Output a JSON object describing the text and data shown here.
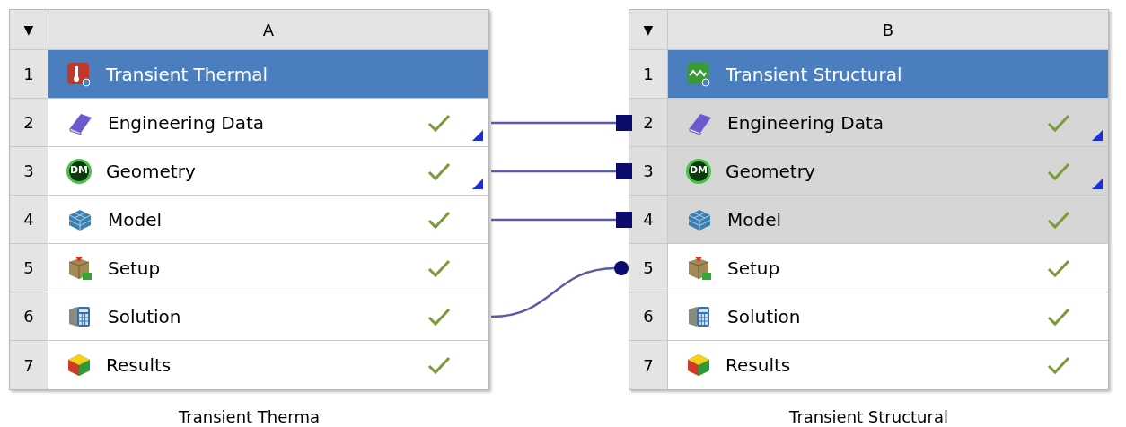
{
  "systems": [
    {
      "column": "A",
      "menu_glyph": "▼",
      "caption": "Transient Therma",
      "rows": [
        {
          "number": "1",
          "kind": "thermal",
          "label": "Transient Thermal",
          "selected": true,
          "shared": false,
          "complete": false,
          "linked": false,
          "connected": false
        },
        {
          "number": "2",
          "kind": "engineering_data",
          "label": "Engineering Data",
          "selected": false,
          "shared": false,
          "complete": true,
          "linked": true,
          "connected": true
        },
        {
          "number": "3",
          "kind": "geometry",
          "icon_label": "DM",
          "label": "Geometry",
          "selected": false,
          "shared": false,
          "complete": true,
          "linked": true,
          "connected": true
        },
        {
          "number": "4",
          "kind": "model",
          "label": "Model",
          "selected": false,
          "shared": false,
          "complete": true,
          "linked": false,
          "connected": true
        },
        {
          "number": "5",
          "kind": "setup",
          "label": "Setup",
          "selected": false,
          "shared": false,
          "complete": true,
          "linked": false,
          "connected": false
        },
        {
          "number": "6",
          "kind": "solution",
          "label": "Solution",
          "selected": false,
          "shared": false,
          "complete": true,
          "linked": false,
          "connected": true
        },
        {
          "number": "7",
          "kind": "results",
          "label": "Results",
          "selected": false,
          "shared": false,
          "complete": true,
          "linked": false,
          "connected": false
        }
      ]
    },
    {
      "column": "B",
      "menu_glyph": "▼",
      "caption": "Transient Structural",
      "rows": [
        {
          "number": "1",
          "kind": "structural",
          "label": "Transient Structural",
          "selected": true,
          "shared": false,
          "complete": false,
          "linked": false,
          "connected": false
        },
        {
          "number": "2",
          "kind": "engineering_data",
          "label": "Engineering Data",
          "selected": false,
          "shared": true,
          "complete": true,
          "linked": true,
          "connected": true
        },
        {
          "number": "3",
          "kind": "geometry",
          "icon_label": "DM",
          "label": "Geometry",
          "selected": false,
          "shared": true,
          "complete": true,
          "linked": true,
          "connected": true
        },
        {
          "number": "4",
          "kind": "model",
          "label": "Model",
          "selected": false,
          "shared": true,
          "complete": true,
          "linked": false,
          "connected": true
        },
        {
          "number": "5",
          "kind": "setup",
          "label": "Setup",
          "selected": false,
          "shared": false,
          "complete": true,
          "linked": false,
          "connected": true
        },
        {
          "number": "6",
          "kind": "solution",
          "label": "Solution",
          "selected": false,
          "shared": false,
          "complete": true,
          "linked": false,
          "connected": false
        },
        {
          "number": "7",
          "kind": "results",
          "label": "Results",
          "selected": false,
          "shared": false,
          "complete": true,
          "linked": false,
          "connected": false
        }
      ]
    }
  ]
}
